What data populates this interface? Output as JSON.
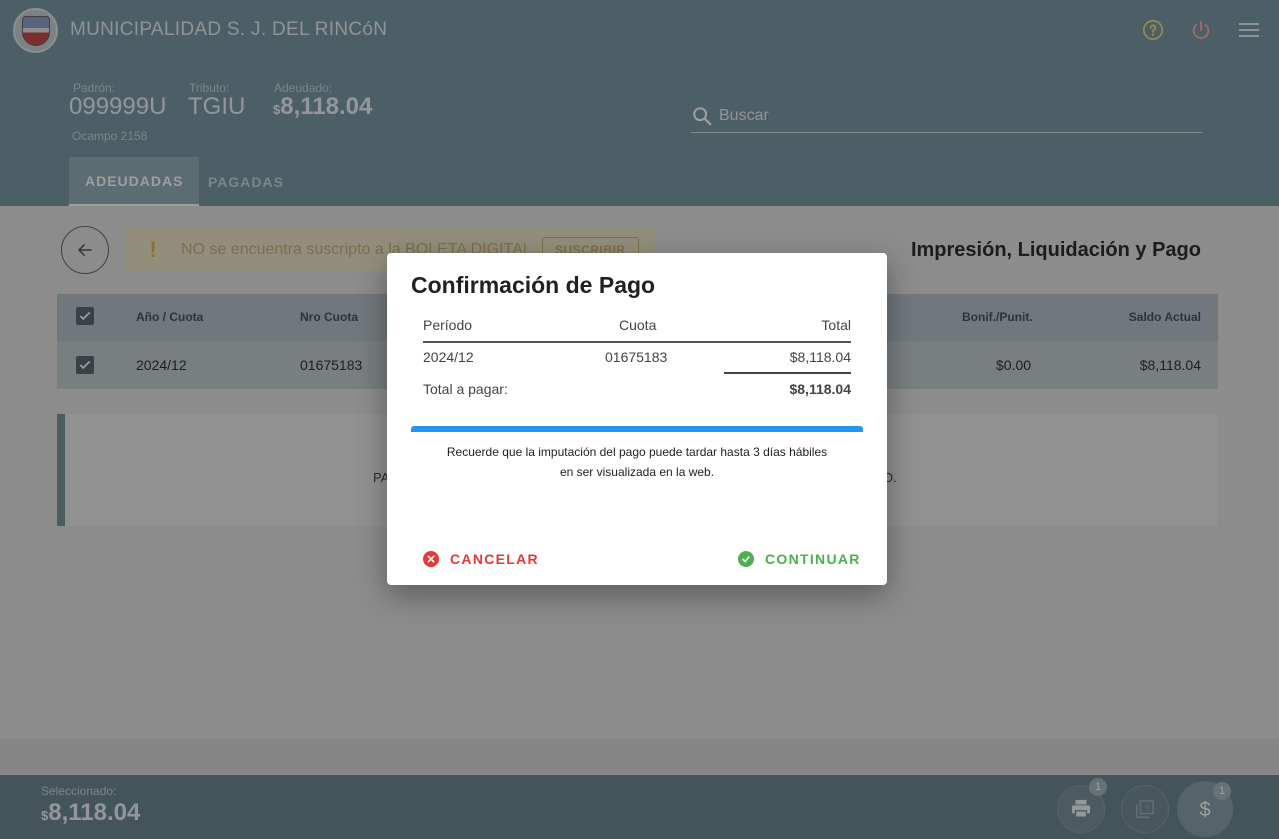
{
  "header": {
    "title": "MUNICIPALIDAD S. J. DEL RINCóN",
    "padron_label": "Padrón:",
    "padron_value": "099999U",
    "tributo_label": "Tributo:",
    "tributo_value": "TGIU",
    "adeudado_label": "Adeudado:",
    "adeudado_currency": "$",
    "adeudado_value": "8,118.04",
    "address": "Ocampo 2158",
    "search_placeholder": "Buscar"
  },
  "tabs": [
    {
      "label": "ADEUDADAS",
      "active": true
    },
    {
      "label": "PAGADAS",
      "active": false
    }
  ],
  "alert": {
    "text": "NO se encuentra suscripto a la BOLETA DIGITAL",
    "button": "SUSCRIBIR"
  },
  "section_title": "Impresión, Liquidación y Pago",
  "table": {
    "headers": [
      "Año / Cuota",
      "Nro Cuota",
      "Bonif./Punit.",
      "Saldo Actual"
    ],
    "row": [
      "2024/12",
      "01675183",
      "$0.00",
      "$8,118.04"
    ]
  },
  "info": {
    "left": "PA",
    "right": "O."
  },
  "bottom": {
    "selected_label": "Seleccionado:",
    "selected_currency": "$",
    "selected_value": "8,118.04",
    "print_badge": "1",
    "pay_badge": "1"
  },
  "dialog": {
    "title": "Confirmación de Pago",
    "col_periodo": "Período",
    "col_cuota": "Cuota",
    "col_total": "Total",
    "periodo": "2024/12",
    "cuota": "01675183",
    "total": "$8,118.04",
    "total_label": "Total a pagar:",
    "total_value": "$8,118.04",
    "note_line1": "Recuerde que la imputación del pago puede tardar hasta 3 días hábiles",
    "note_line2": "en ser visualizada en la web.",
    "cancel": "CANCELAR",
    "continue": "CONTINUAR"
  },
  "colors": {
    "header": "#7b9aa7",
    "primary_blue": "#2196f3",
    "cancel_red": "#e53935",
    "continue_green": "#4caf50"
  }
}
